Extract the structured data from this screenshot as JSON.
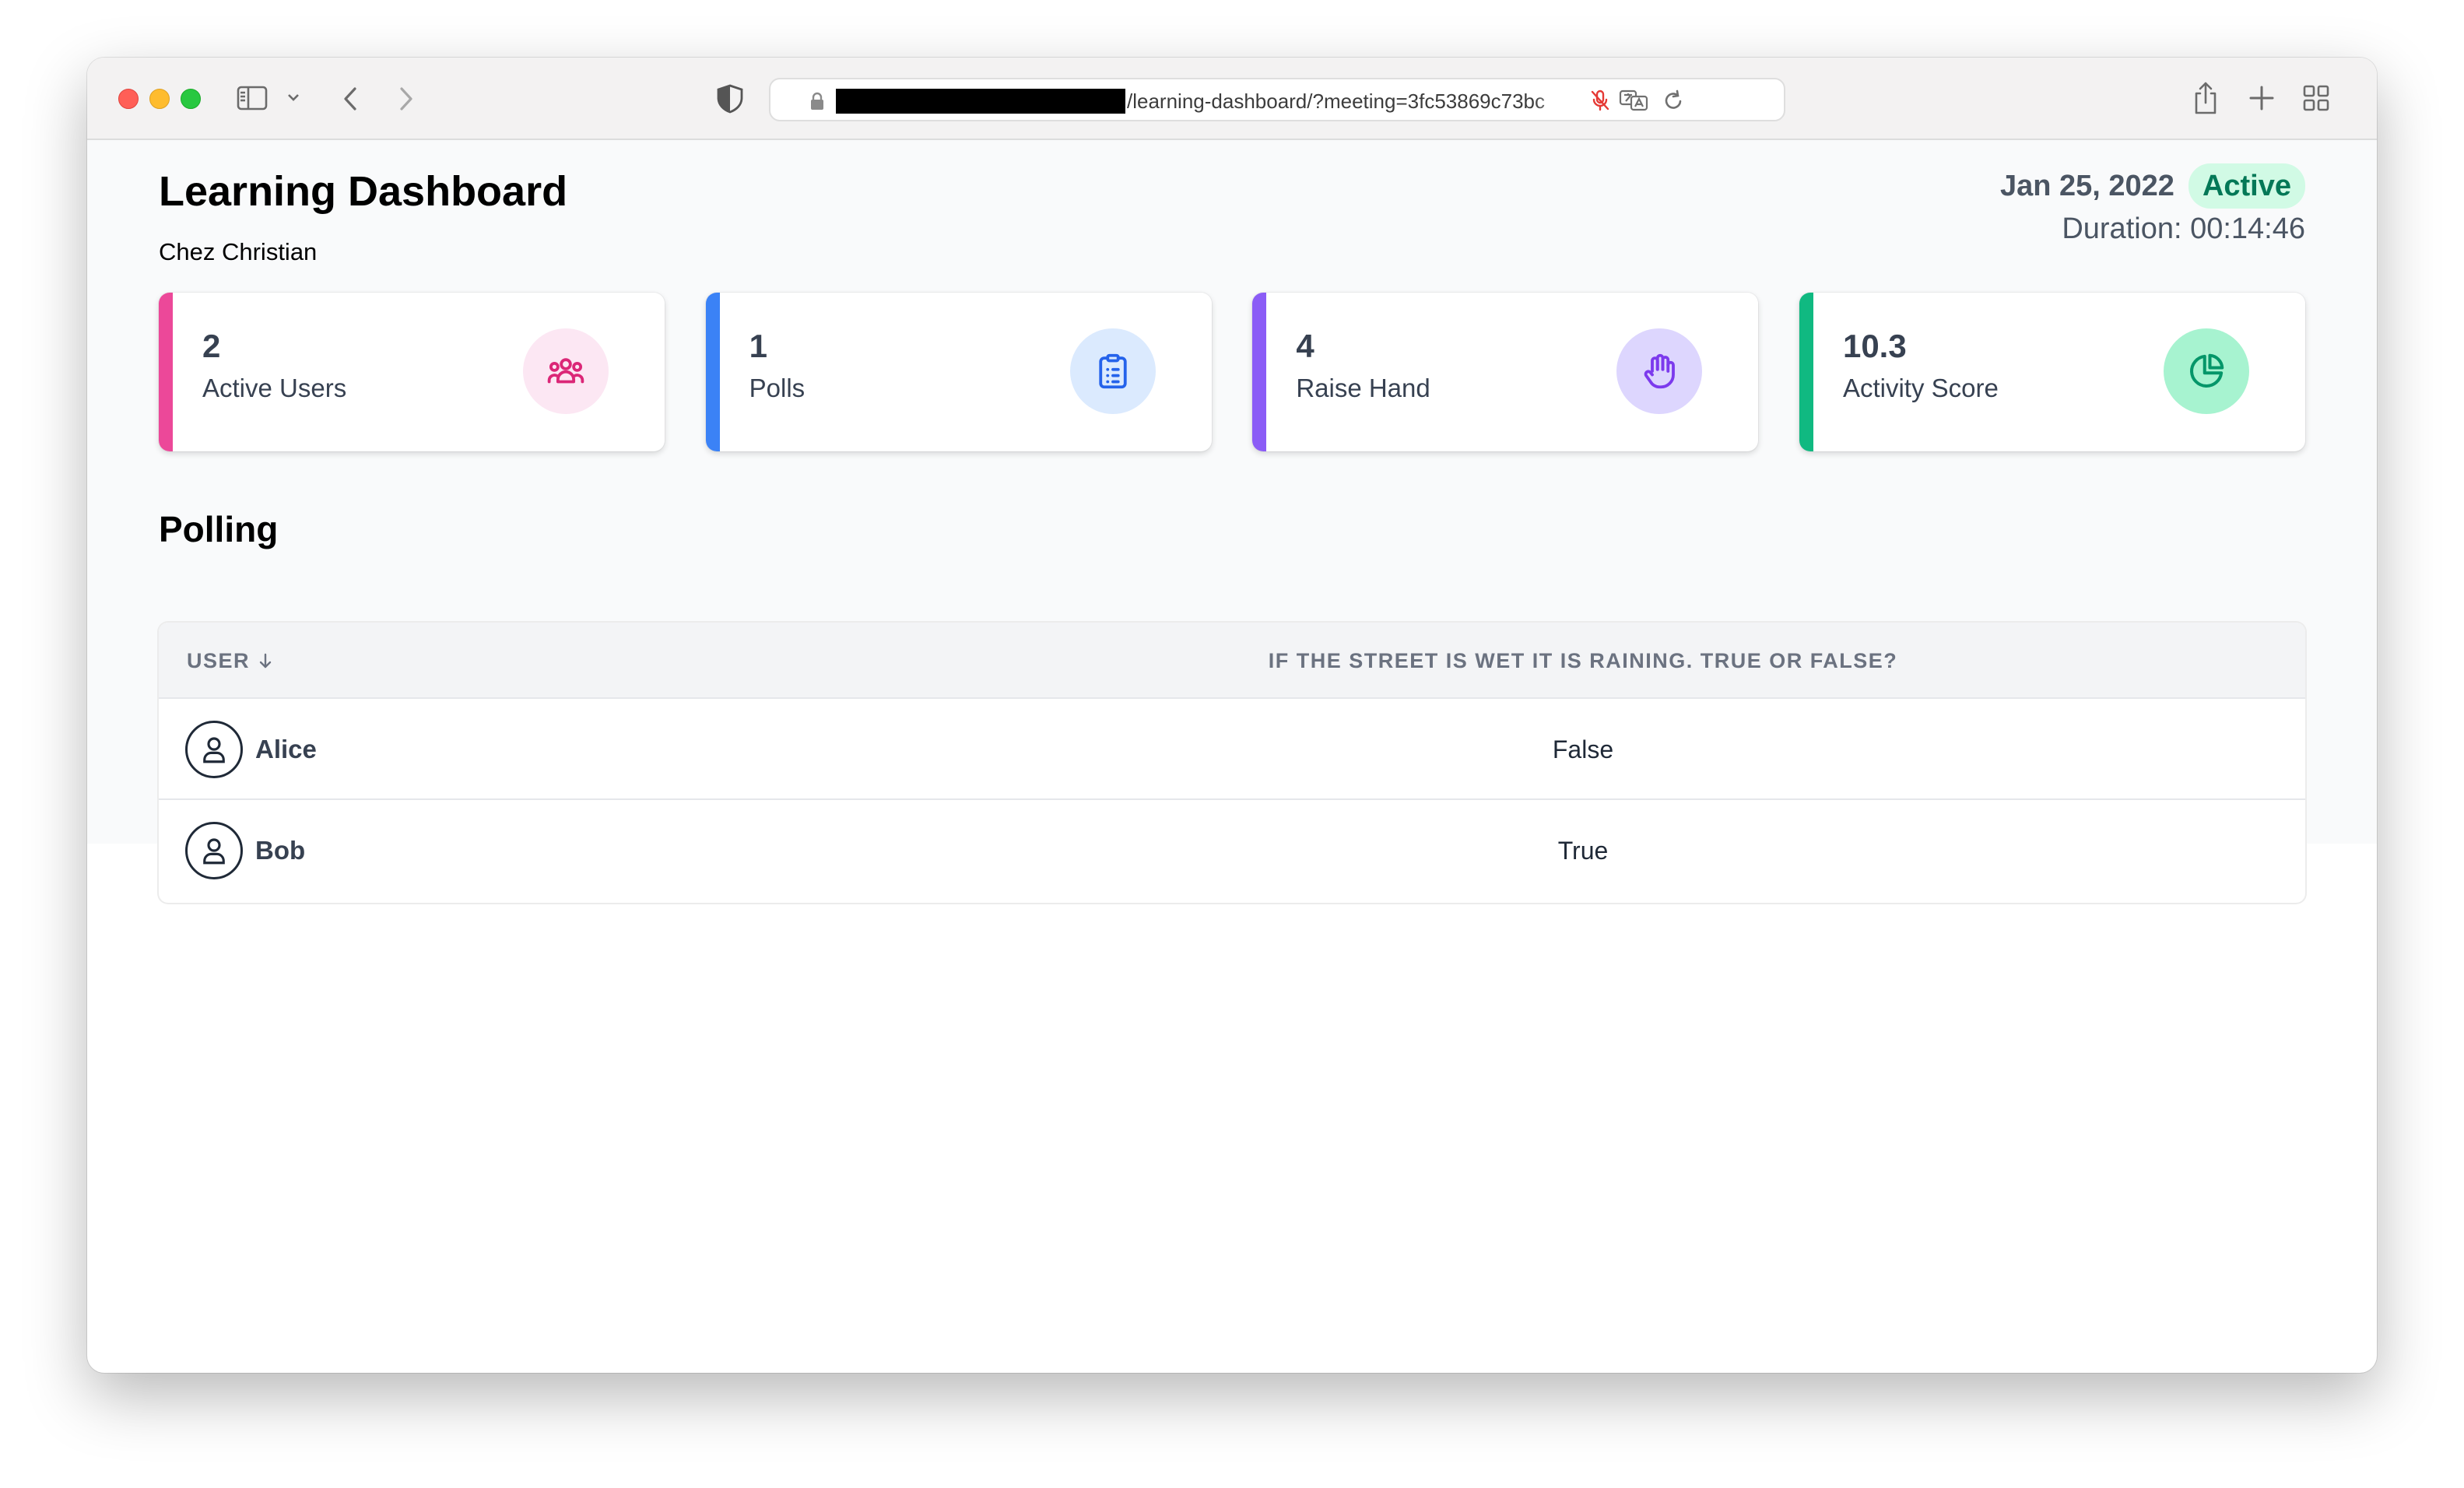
{
  "browser": {
    "url_visible": "/learning-dashboard/?meeting=3fc53869c73bc"
  },
  "dashboard": {
    "title": "Learning Dashboard",
    "meeting_name": "Chez Christian",
    "date": "Jan 25, 2022",
    "status": "Active",
    "duration": "Duration: 00:14:46"
  },
  "cards": [
    {
      "value": "2",
      "label": "Active Users",
      "icon": "users-icon",
      "accent": "#ec4899"
    },
    {
      "value": "1",
      "label": "Polls",
      "icon": "clipboard-list-icon",
      "accent": "#3b82f6"
    },
    {
      "value": "4",
      "label": "Raise Hand",
      "icon": "raised-hand-icon",
      "accent": "#8b5cf6"
    },
    {
      "value": "10.3",
      "label": "Activity Score",
      "icon": "pie-chart-icon",
      "accent": "#10b981"
    }
  ],
  "polling": {
    "title": "Polling",
    "columns": [
      "USER",
      "IF THE STREET IS WET IT IS RAINING. TRUE OR FALSE?"
    ],
    "rows": [
      {
        "user": "Alice",
        "answer": "False"
      },
      {
        "user": "Bob",
        "answer": "True"
      }
    ]
  }
}
